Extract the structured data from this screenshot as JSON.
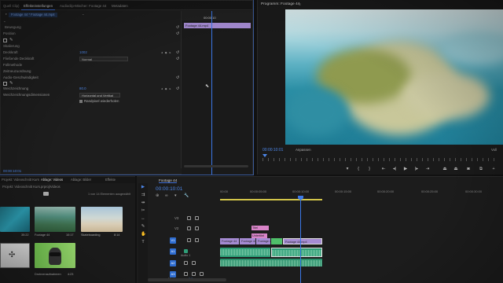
{
  "effect_controls": {
    "tabs": [
      "Quell Clip)",
      "Effekteinstellungen",
      "Audioclip-Mischer: Footage 44",
      "Metadaten"
    ],
    "clip_path": "Footage 44 * Footage 44.mp4",
    "rows": [
      {
        "label": "Bewegung"
      },
      {
        "label": "Position",
        "value": "1002"
      },
      {
        "label": "Skalierung"
      },
      {
        "label": "Deckkraft"
      },
      {
        "label": "Fließende Deckkraft",
        "value": "100.0 %"
      },
      {
        "label": "Füllmethode",
        "select": "Normal"
      },
      {
        "label": "Zeitneuzuordnung"
      },
      {
        "label": "Audio-Geschwindigkeit"
      },
      {
        "label": "Weichzeichnung",
        "value": "80.0"
      },
      {
        "label": "Weichzeichnungsdimensionen",
        "select": "Horizontal und Vertikal"
      },
      {
        "label": "",
        "checkbox": "Randpixel wiederholen"
      }
    ],
    "timeline_clip": "Footage 44.mp4",
    "timecode": "00:00:10:01",
    "ruler_tc": "00:00:10"
  },
  "program_monitor": {
    "title": "Programm: Footage 44",
    "menu_icon": "hamburger-icon",
    "timecode": "00:00:10:01",
    "fit": "Anpassen",
    "zoom": "Voll",
    "duration_label": "1/2",
    "playhead_fraction": 0.0
  },
  "project": {
    "tabs": [
      "Projekt: Videoschnitt Kurs",
      "Ablage: Videos",
      "Ablage: Bilder",
      "Effekte"
    ],
    "path": "Projekt: Videoschnitt Kurs.prproj\\Videos",
    "count": "1 von 14 Elementen ausgewählt",
    "items": [
      {
        "name": "",
        "duration": "35:22"
      },
      {
        "name": "Footage 44",
        "duration": "10:17"
      },
      {
        "name": "Skateboarding",
        "duration": "8:14"
      },
      {
        "name": "",
        "duration": ""
      },
      {
        "name": "Drohnenaufnahmen",
        "duration": "4:23"
      }
    ]
  },
  "timeline": {
    "tab": "Footage 44",
    "timecode": "00:00:10:01",
    "ruler": [
      "00:00",
      "00:00:05:00",
      "00:00:10:00",
      "00:00:15:00",
      "00:00:20:00",
      "00:00:25:00",
      "00:00:30:00"
    ],
    "tracks": {
      "v3": "V3",
      "v2": "V2",
      "v1": "V1",
      "a1": "A1",
      "a2": "A2",
      "a3": "A3",
      "audio_label": "Audio 1",
      "master": "Master"
    },
    "title_clip": "Titel",
    "title_clip_2": "Untertitel",
    "video_clips": [
      "Footage 44",
      "Footage 44",
      "Footage 44",
      "Footage 44.mp4"
    ],
    "master_level": "0.0"
  }
}
